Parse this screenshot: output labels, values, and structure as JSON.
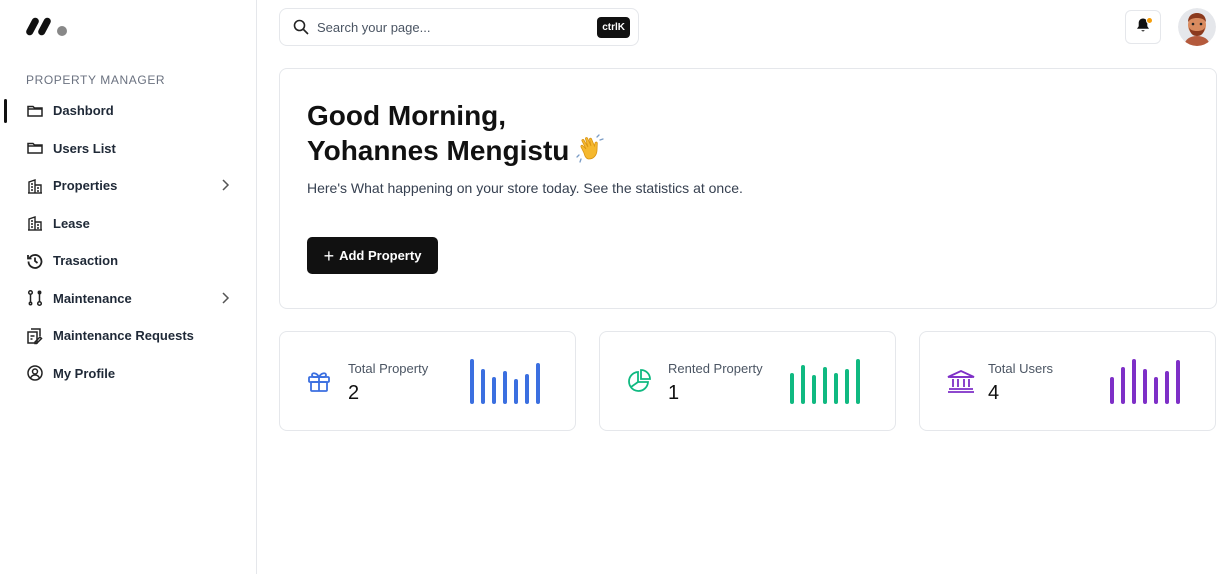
{
  "sidebar": {
    "section_label": "PROPERTY MANAGER",
    "items": [
      {
        "label": "Dashbord",
        "icon": "folder-icon"
      },
      {
        "label": "Users List",
        "icon": "folder-icon"
      },
      {
        "label": "Properties",
        "icon": "building-icon"
      },
      {
        "label": "Lease",
        "icon": "building-icon"
      },
      {
        "label": "Trasaction",
        "icon": "history-icon"
      },
      {
        "label": "Maintenance",
        "icon": "route-icon"
      },
      {
        "label": "Maintenance Requests",
        "icon": "edit-doc-icon"
      },
      {
        "label": "My Profile",
        "icon": "user-circle-icon"
      }
    ]
  },
  "search": {
    "placeholder": "Search your page...",
    "shortcut": "ctrlK"
  },
  "welcome": {
    "greeting_line1": "Good Morning,",
    "greeting_line2": "Yohannes Mengistu",
    "subtitle": "Here's What happening on your store today. See the statistics at once.",
    "add_button": "Add Property"
  },
  "stats": [
    {
      "label": "Total Property",
      "value": "2",
      "color": "#3b6fe0",
      "icon": "gift-icon"
    },
    {
      "label": "Rented Property",
      "value": "1",
      "color": "#10b981",
      "icon": "pie-chart-icon"
    },
    {
      "label": "Total Users",
      "value": "4",
      "color": "#7e2fc7",
      "icon": "bank-icon"
    }
  ],
  "colors": {
    "accent": "#111111",
    "notification_dot": "#f59e0b"
  }
}
